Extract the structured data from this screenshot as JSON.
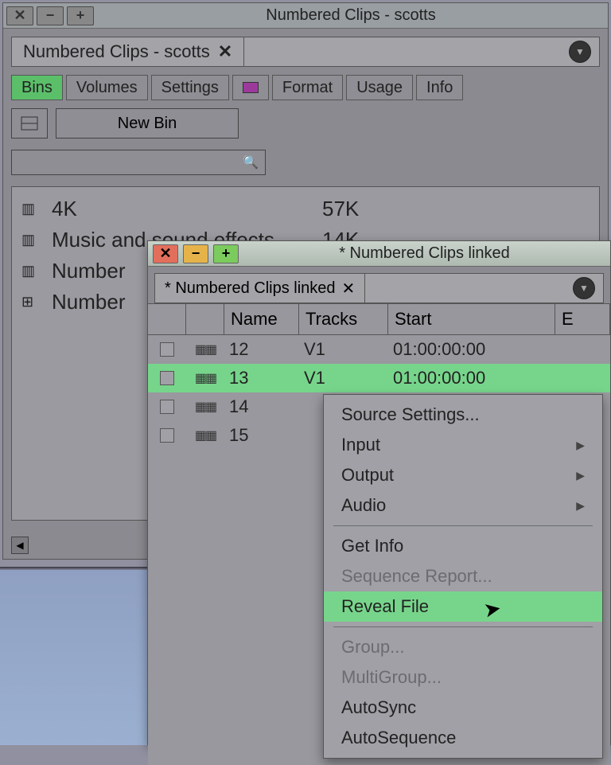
{
  "mainWindow": {
    "title": "Numbered Clips - scotts",
    "docTab": "Numbered Clips - scotts",
    "toolbar": {
      "bins": "Bins",
      "volumes": "Volumes",
      "settings": "Settings",
      "format": "Format",
      "usage": "Usage",
      "info": "Info"
    },
    "newBin": "New Bin",
    "items": [
      {
        "icon": "bin",
        "name": "4K",
        "size": "57K"
      },
      {
        "icon": "bin",
        "name": "Music and sound effects",
        "size": "14K"
      },
      {
        "icon": "bin",
        "name": "Number",
        "size": ""
      },
      {
        "icon": "seq",
        "name": "Number",
        "size": ""
      }
    ]
  },
  "binWindow": {
    "title": "* Numbered Clips linked",
    "docTab": "* Numbered Clips linked",
    "headers": {
      "c1": "",
      "c2": "",
      "name": "Name",
      "tracks": "Tracks",
      "start": "Start",
      "end": "E"
    },
    "rows": [
      {
        "name": "12",
        "tracks": "V1",
        "start": "01:00:00:00",
        "selected": false
      },
      {
        "name": "13",
        "tracks": "V1",
        "start": "01:00:00:00",
        "selected": true
      },
      {
        "name": "14",
        "tracks": "",
        "start": "",
        "selected": false
      },
      {
        "name": "15",
        "tracks": "",
        "start": "",
        "selected": false
      }
    ]
  },
  "contextMenu": {
    "sourceSettings": "Source Settings...",
    "input": "Input",
    "output": "Output",
    "audio": "Audio",
    "getInfo": "Get Info",
    "sequenceReport": "Sequence Report...",
    "revealFile": "Reveal File",
    "group": "Group...",
    "multiGroup": "MultiGroup...",
    "autoSync": "AutoSync",
    "autoSequence": "AutoSequence"
  }
}
